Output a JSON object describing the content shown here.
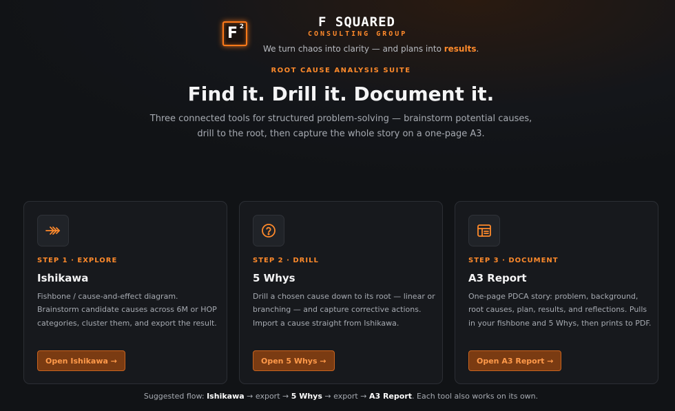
{
  "brand": {
    "logo_letter": "F",
    "logo_superscript": "2",
    "name": "F SQUARED",
    "subtitle": "CONSULTING GROUP",
    "tagline_prefix": "We turn chaos into clarity — and plans into ",
    "tagline_highlight": "results",
    "tagline_suffix": ".",
    "accent_color": "#ff8a2b"
  },
  "hero": {
    "eyebrow": "ROOT CAUSE ANALYSIS SUITE",
    "headline": "Find it. Drill it. Document it.",
    "intro": "Three connected tools for structured problem-solving — brainstorm potential causes, drill to the root, then capture the whole story on a one-page A3."
  },
  "cards": [
    {
      "icon": "fishbone-icon",
      "step": "STEP 1 · EXPLORE",
      "title": "Ishikawa",
      "description": "Fishbone / cause-and-effect diagram. Brainstorm candidate causes across 6M or HOP categories, cluster them, and export the result.",
      "button": "Open Ishikawa →"
    },
    {
      "icon": "question-circle-icon",
      "step": "STEP 2 · DRILL",
      "title": "5 Whys",
      "description": "Drill a chosen cause down to its root — linear or branching — and capture corrective actions. Import a cause straight from Ishikawa.",
      "button": "Open 5 Whys →"
    },
    {
      "icon": "report-layout-icon",
      "step": "STEP 3 · DOCUMENT",
      "title": "A3 Report",
      "description": "One-page PDCA story: problem, background, root causes, plan, results, and reflections. Pulls in your fishbone and 5 Whys, then prints to PDF.",
      "button": "Open A3 Report →"
    }
  ],
  "footer": {
    "prefix": "Suggested flow: ",
    "step1": "Ishikawa",
    "arrow1": " → export → ",
    "step2": "5 Whys",
    "arrow2": " → export → ",
    "step3": "A3 Report",
    "suffix": ". Each tool also works on its own."
  }
}
